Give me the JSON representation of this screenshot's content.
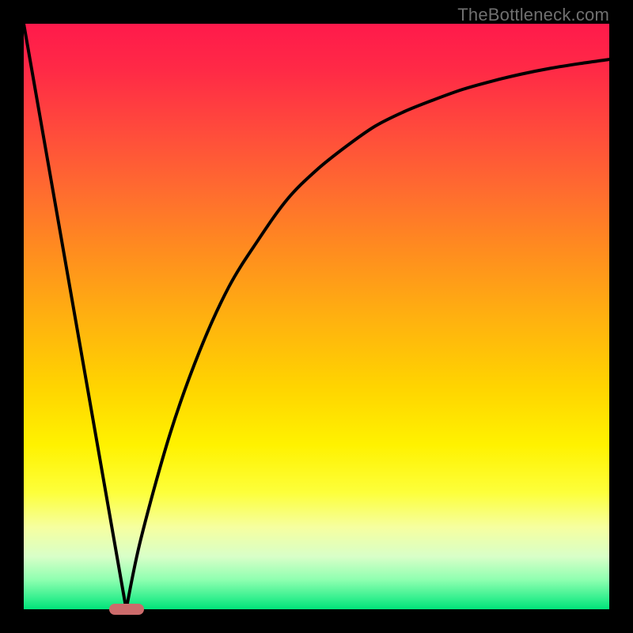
{
  "attribution": "TheBottleneck.com",
  "colors": {
    "frame": "#000000",
    "curve": "#000000",
    "marker": "#cc6b6b",
    "gradient_top": "#ff1a4b",
    "gradient_bottom": "#00e37a"
  },
  "chart_data": {
    "type": "line",
    "title": "",
    "xlabel": "",
    "ylabel": "",
    "xlim": [
      0,
      100
    ],
    "ylim": [
      0,
      100
    ],
    "series": [
      {
        "name": "left-segment",
        "x": [
          0,
          17.5
        ],
        "y": [
          100,
          0
        ]
      },
      {
        "name": "right-segment",
        "x": [
          17.5,
          20,
          25,
          30,
          35,
          40,
          45,
          50,
          55,
          60,
          65,
          70,
          75,
          80,
          85,
          90,
          95,
          100
        ],
        "y": [
          0,
          12,
          30,
          44,
          55,
          63,
          70,
          75,
          79,
          82.5,
          85,
          87,
          88.8,
          90.2,
          91.4,
          92.4,
          93.2,
          93.9
        ]
      }
    ],
    "marker": {
      "x": 17.5,
      "y": 0
    },
    "grid": false,
    "legend": false
  }
}
